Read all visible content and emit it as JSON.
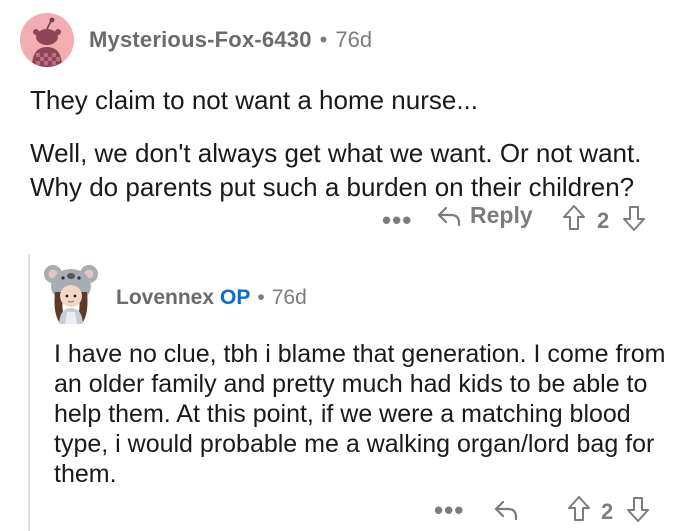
{
  "comment": {
    "username": "Mysterious-Fox-6430",
    "separator": "•",
    "age": "76d",
    "paragraphs": [
      "They claim to not want a home nurse...",
      "Well, we don't always get what we want. Or not want. Why do parents put such a burden on their children?"
    ],
    "more_label": "•••",
    "reply_label": "Reply",
    "score": "2"
  },
  "reply": {
    "username": "Lovennex",
    "op_badge": "OP",
    "separator": "•",
    "age": "76d",
    "body": "I have no clue, tbh i blame that generation. I come from an older family and pretty much had kids to be able to help them. At this point, if we were a matching blood type, i would probable me a walking organ/lord bag for them.",
    "more_label": "•••",
    "score": "2"
  },
  "colors": {
    "avatar_bg": "#f0aeb2",
    "op_blue": "#0a6bd1",
    "meta_gray": "#7c7c7c",
    "thread_line": "#e0e0e0"
  },
  "icons": {
    "reply": "reply-arrow-icon",
    "upvote": "upvote-arrow-icon",
    "downvote": "downvote-arrow-icon"
  }
}
